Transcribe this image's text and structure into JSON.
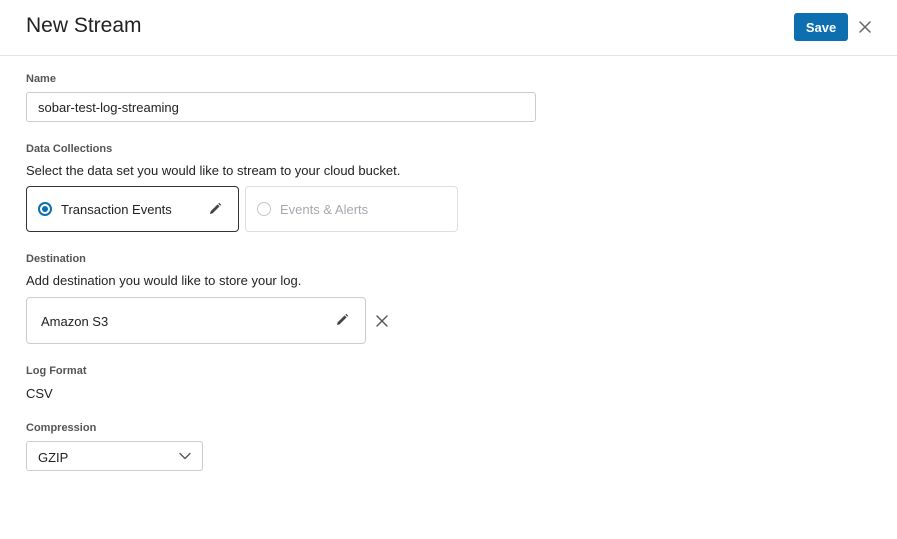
{
  "header": {
    "title": "New Stream",
    "save_label": "Save"
  },
  "name": {
    "label": "Name",
    "value": "sobar-test-log-streaming"
  },
  "data_collections": {
    "label": "Data Collections",
    "description": "Select the data set you would like to stream to your cloud bucket.",
    "options": [
      {
        "label": "Transaction Events",
        "selected": true
      },
      {
        "label": "Events & Alerts",
        "selected": false
      }
    ]
  },
  "destination": {
    "label": "Destination",
    "description": "Add destination you would like to store your log.",
    "value": "Amazon S3"
  },
  "log_format": {
    "label": "Log Format",
    "value": "CSV"
  },
  "compression": {
    "label": "Compression",
    "value": "GZIP"
  },
  "colors": {
    "accent": "#0d6fb0",
    "border": "#c8ccd0",
    "muted_text": "#a4a8ac"
  }
}
